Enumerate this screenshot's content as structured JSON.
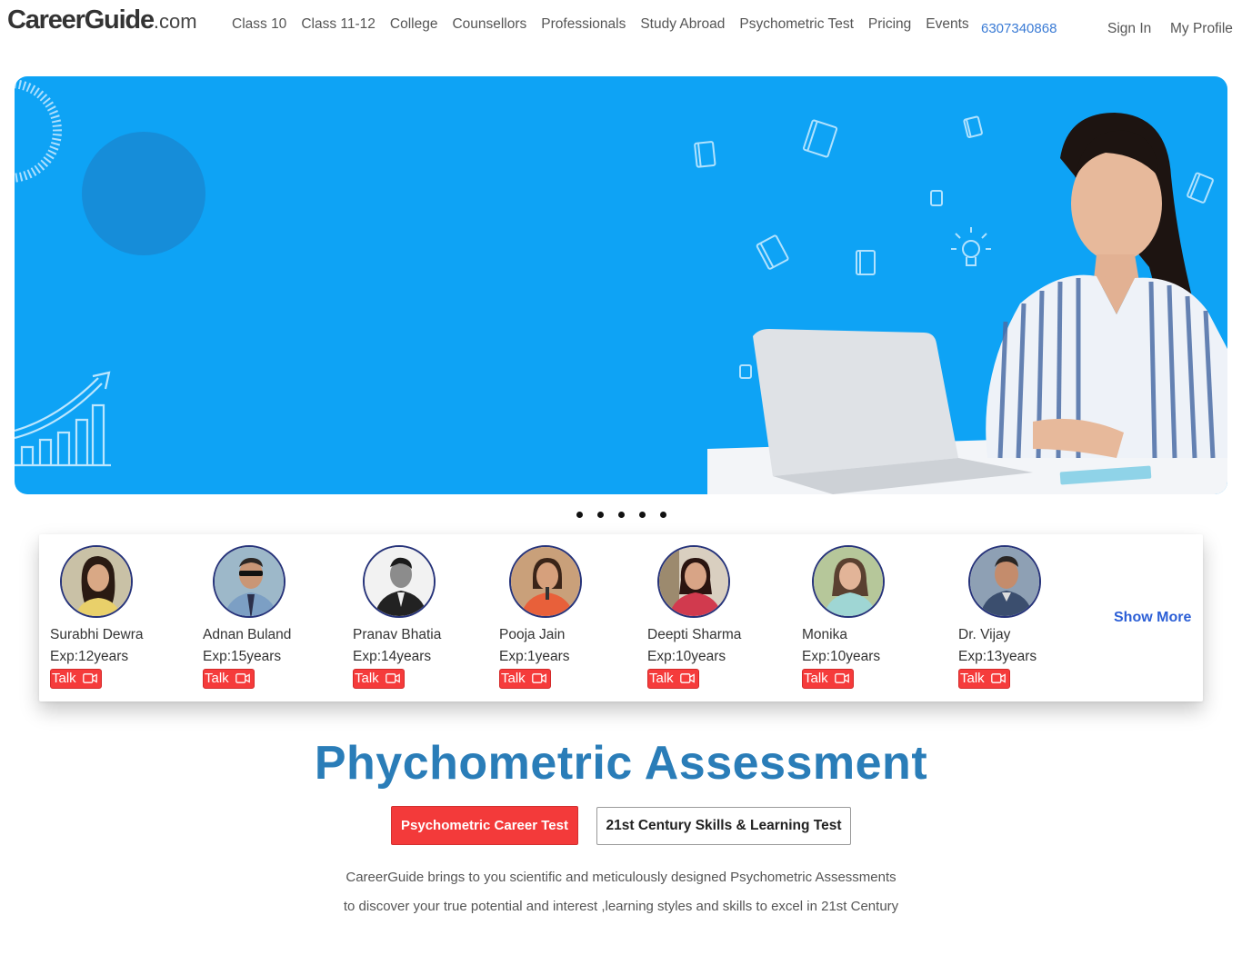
{
  "header": {
    "logo_main": "CareerGuide",
    "logo_suffix": ".com",
    "nav": [
      "Class 10",
      "Class 11-12",
      "College",
      "Counsellors",
      "Professionals",
      "Study Abroad",
      "Psychometric Test",
      "Pricing",
      "Events"
    ],
    "phone": "6307340868",
    "sign_in": "Sign In",
    "my_profile": "My Profile"
  },
  "hero": {
    "background_color": "#0ea3f5",
    "carousel_dots": 5
  },
  "counsellors": {
    "items": [
      {
        "name": "Surabhi Dewra",
        "exp": "Exp:12years",
        "talk": "Talk"
      },
      {
        "name": "Adnan Buland",
        "exp": "Exp:15years",
        "talk": "Talk"
      },
      {
        "name": "Pranav Bhatia",
        "exp": "Exp:14years",
        "talk": "Talk"
      },
      {
        "name": "Pooja Jain",
        "exp": "Exp:1years",
        "talk": "Talk"
      },
      {
        "name": "Deepti Sharma",
        "exp": "Exp:10years",
        "talk": "Talk"
      },
      {
        "name": "Monika",
        "exp": "Exp:10years",
        "talk": "Talk"
      },
      {
        "name": "Dr. Vijay",
        "exp": "Exp:13years",
        "talk": "Talk"
      }
    ],
    "show_more": "Show More"
  },
  "assessment": {
    "title": "Phychometric Assessment",
    "primary_button": "Psychometric Career Test",
    "secondary_button": "21st Century Skills & Learning Test",
    "description_line1": "CareerGuide brings to you scientific and meticulously designed Psychometric Assessments",
    "description_line2": "to discover your true potential and interest ,learning styles and skills to excel in 21st Century"
  },
  "colors": {
    "accent_blue": "#2a7db8",
    "talk_red": "#f53b3b",
    "link_blue": "#2c5fd6"
  }
}
